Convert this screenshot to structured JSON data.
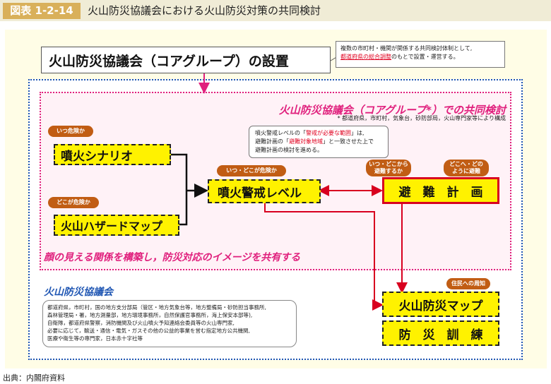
{
  "header": {
    "figure_tag": "図表 1-2-14",
    "title": "火山防災協議会における火山防災対策の共同検討"
  },
  "core_group": {
    "title": "火山防災協議会（コアグループ）の設置",
    "note_prefix": "複数の市町村・機関が関係する共同検討体制として,",
    "note_highlight": "都道府県の総合調整",
    "note_suffix": "のもとで設置・運営する。"
  },
  "joint_study": {
    "title": "火山防災協議会（コアグループ*）での共同検討",
    "footnote": "* 都道府県，市町村，気象台，砂防部局，火山専門家等により構成"
  },
  "alert_note": {
    "p1": "噴火警戒レベルの「",
    "h1": "警戒が必要な範囲",
    "p2": "」は,",
    "p3": "避難計画の「",
    "h2": "避難対象地域",
    "p4": "」と一致させた上で",
    "p5": "避難計画の検討を進める。"
  },
  "boxes": {
    "eruption_scenario": "噴火シナリオ",
    "hazard_map": "火山ハザードマップ",
    "alert_level": "噴火警戒レベル",
    "evacuation_plan": "避　難　計　画",
    "volcano_map": "火山防災マップ",
    "drill": "防　災　訓　練"
  },
  "badges": {
    "when_danger": "いつ危険か",
    "where_danger": "どこが危険か",
    "when_where": "いつ・どこが危険か",
    "when_where_evac": "いつ・どこから\n避難するか",
    "where_how_evac": "どこへ・どの\nように避難",
    "notify_residents": "住民への周知"
  },
  "shared_image": "顔の見える関係を構築し，防災対応のイメージを共有する",
  "council": {
    "title": "火山防災協議会",
    "members": [
      "都道府県，市町村，国の地方支分部局（管区・地方気象台等，地方整備局・砂防担当事務所,",
      "森林管理局・署，地方測量部，地方環境事務所，自然保護官事務所，海上保安本部等),",
      "自衛隊，都道府県警察，消防機関及び火山噴火予知連絡会委員等の火山専門家,",
      "必要に応じて，輸送・通信・電気・ガスその他の公益的事業を営む指定地方公共機関,",
      "医療や衛生等の専門家，日本赤十字社等"
    ]
  },
  "source": "出典：内閣府資料",
  "colors": {
    "magenta": "#e0207d",
    "blue": "#1f56b3",
    "red": "#d8001f",
    "yellow": "#fff200",
    "badge": "#c15d14"
  }
}
